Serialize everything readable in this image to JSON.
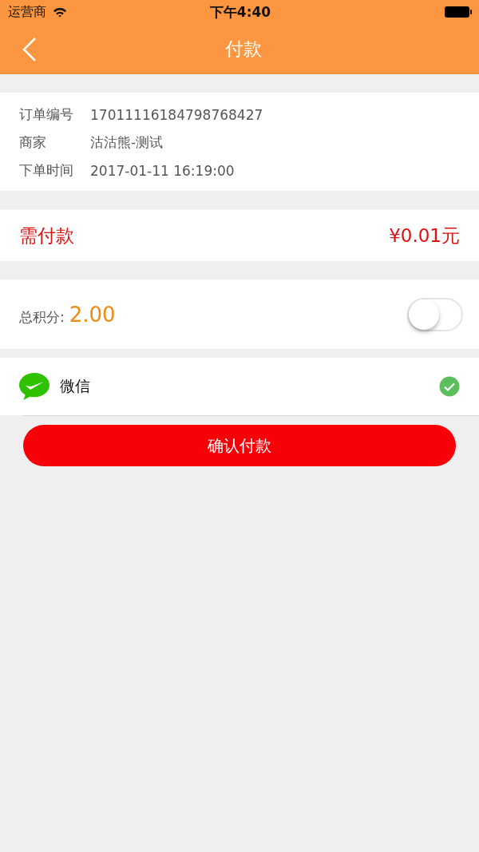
{
  "status_bar": {
    "carrier": "运营商",
    "time": "下午4:40"
  },
  "nav": {
    "title": "付款"
  },
  "order_info": [
    {
      "label": "订单编号",
      "value": "17011116184798768427"
    },
    {
      "label": "商家",
      "value": "沽沽熊-测试"
    },
    {
      "label": "下单时间",
      "value": "2017-01-11 16:19:00"
    }
  ],
  "amount_due": {
    "label": "需付款",
    "value": "¥0.01元"
  },
  "points": {
    "label": "总积分:",
    "value": "2.00",
    "on": false
  },
  "payment_methods": [
    {
      "name": "微信",
      "selected": true
    }
  ],
  "confirm_button": "确认付款"
}
